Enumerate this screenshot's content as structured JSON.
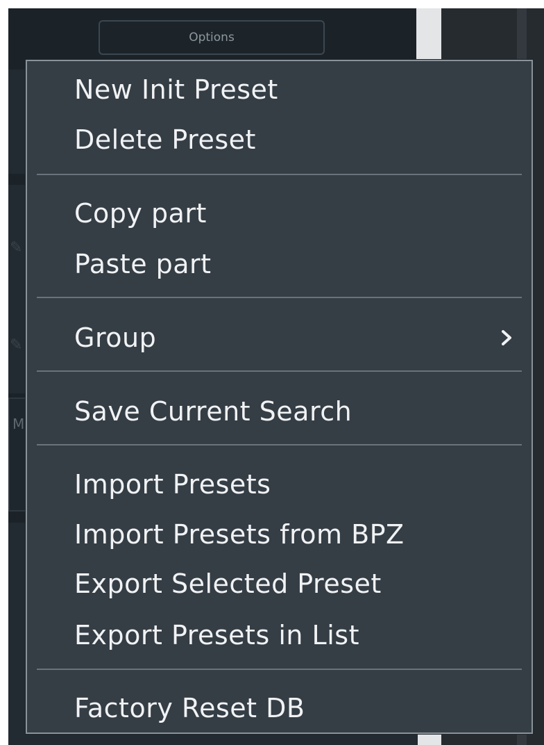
{
  "background": {
    "options_button_label": "Options",
    "box_letter": "M"
  },
  "menu": {
    "groups": [
      {
        "items": [
          {
            "label": "New Init Preset"
          },
          {
            "label": "Delete Preset"
          }
        ]
      },
      {
        "items": [
          {
            "label": "Copy part"
          },
          {
            "label": "Paste part"
          }
        ]
      },
      {
        "items": [
          {
            "label": "Group",
            "submenu": true
          }
        ]
      },
      {
        "items": [
          {
            "label": "Save Current Search"
          }
        ]
      },
      {
        "items": [
          {
            "label": "Import Presets"
          },
          {
            "label": "Import Presets from BPZ"
          },
          {
            "label": "Export Selected Preset"
          },
          {
            "label": "Export Presets in List"
          }
        ]
      },
      {
        "items": [
          {
            "label": "Factory Reset DB"
          }
        ]
      }
    ],
    "submenu_icon": "chevron-right-icon"
  },
  "colors": {
    "menu_background": "#353d45",
    "menu_border": "#8b939a",
    "menu_text": "#f0f2f4",
    "separator": "#6a737b"
  }
}
